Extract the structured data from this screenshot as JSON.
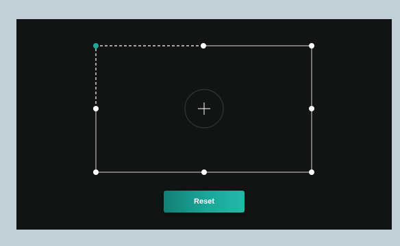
{
  "reset_button": {
    "label": "Reset"
  },
  "colors": {
    "frame_background": "#c3cfd6",
    "canvas_background": "#121413",
    "accent": "#1ba79a",
    "selection_outline": "#d9d9d9",
    "handle_fill": "#ffffff",
    "active_handle_fill": "#1ba79a"
  },
  "icons": {
    "center": "plus-icon",
    "handles": "circle-handle-icon"
  },
  "selection": {
    "active_handle": "top-left"
  }
}
